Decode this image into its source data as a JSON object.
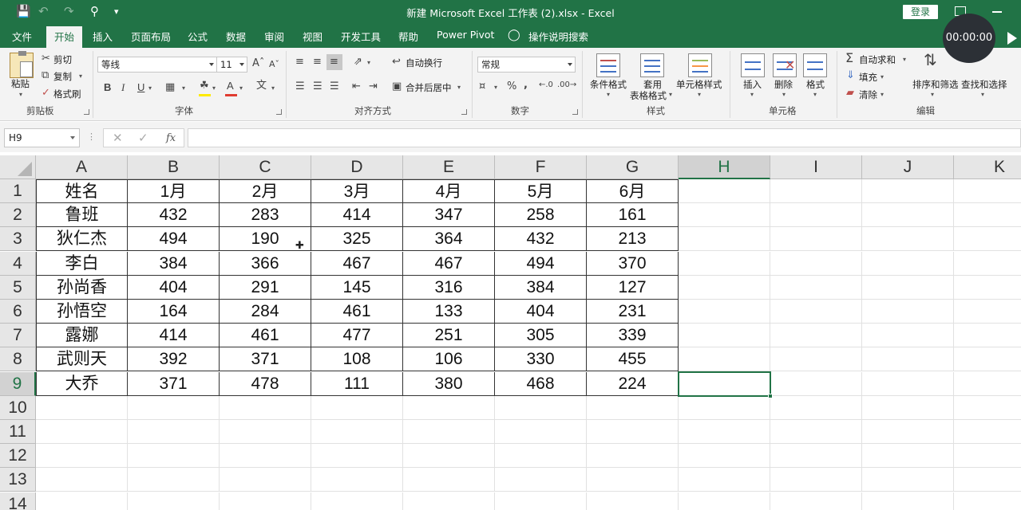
{
  "titlebar": {
    "title": "新建 Microsoft Excel 工作表 (2).xlsx  -  Excel",
    "login": "登录",
    "icons": [
      "save-icon",
      "undo-icon",
      "redo-icon",
      "print-preview-icon",
      "customize-icon"
    ]
  },
  "timer": "00:00:00",
  "tabs": [
    "文件",
    "开始",
    "插入",
    "页面布局",
    "公式",
    "数据",
    "审阅",
    "视图",
    "开发工具",
    "帮助",
    "Power Pivot",
    "操作说明搜索"
  ],
  "ribbon": {
    "clipboard": {
      "paste": "粘贴",
      "cut": "剪切",
      "copy": "复制",
      "format_painter": "格式刷",
      "label": "剪贴板"
    },
    "font": {
      "name": "等线",
      "size": "11",
      "bold": "B",
      "italic": "I",
      "underline": "U",
      "label": "字体"
    },
    "alignment": {
      "wrap": "自动换行",
      "merge": "合并后居中",
      "label": "对齐方式"
    },
    "number": {
      "format": "常规",
      "label": "数字"
    },
    "styles": {
      "conditional": "条件格式",
      "table_line1": "套用",
      "table_line2": "表格格式",
      "cell_styles": "单元格样式",
      "label": "样式"
    },
    "cells": {
      "insert": "插入",
      "delete": "删除",
      "format": "格式",
      "label": "单元格"
    },
    "editing": {
      "autosum": "自动求和",
      "fill": "填充",
      "clear": "清除",
      "sort": "排序和筛选",
      "find": "查找和选择",
      "label": "编辑"
    }
  },
  "formula_bar": {
    "name_box": "H9",
    "fx": "fx",
    "value": ""
  },
  "sheet": {
    "columns": [
      "A",
      "B",
      "C",
      "D",
      "E",
      "F",
      "G",
      "H",
      "I",
      "J",
      "K"
    ],
    "rows": [
      "1",
      "2",
      "3",
      "4",
      "5",
      "6",
      "7",
      "8",
      "9",
      "10",
      "11",
      "12",
      "13",
      "14"
    ],
    "selected_cell": "H9",
    "data": [
      [
        "姓名",
        "1月",
        "2月",
        "3月",
        "4月",
        "5月",
        "6月"
      ],
      [
        "鲁班",
        "432",
        "283",
        "414",
        "347",
        "258",
        "161"
      ],
      [
        "狄仁杰",
        "494",
        "190",
        "325",
        "364",
        "432",
        "213"
      ],
      [
        "李白",
        "384",
        "366",
        "467",
        "467",
        "494",
        "370"
      ],
      [
        "孙尚香",
        "404",
        "291",
        "145",
        "316",
        "384",
        "127"
      ],
      [
        "孙悟空",
        "164",
        "284",
        "461",
        "133",
        "404",
        "231"
      ],
      [
        "露娜",
        "414",
        "461",
        "477",
        "251",
        "305",
        "339"
      ],
      [
        "武则天",
        "392",
        "371",
        "108",
        "106",
        "330",
        "455"
      ],
      [
        "大乔",
        "371",
        "478",
        "111",
        "380",
        "468",
        "224"
      ]
    ]
  }
}
